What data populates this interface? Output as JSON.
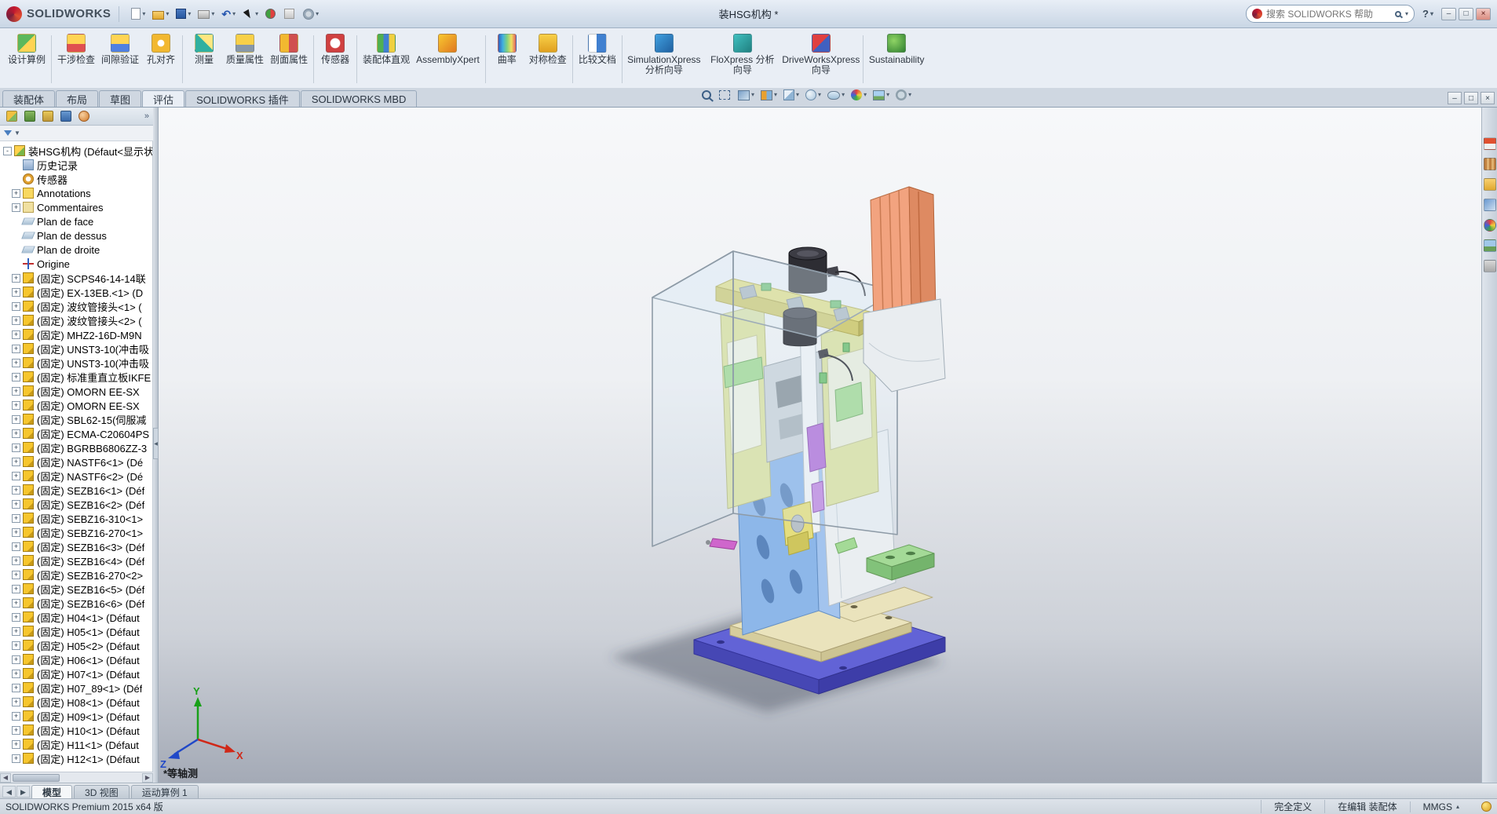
{
  "colors": {
    "titlebar-top": "#e8eef6",
    "titlebar-bottom": "#c9d6e5",
    "ribbon-bg": "#e9eef5",
    "tabrow-bg": "#cfd7e1",
    "panel-bg": "#f2f4f7",
    "tree-bg": "#ffffff",
    "status-bg": "#dde3ea",
    "vp-top": "#f7f8fa",
    "vp-mid": "#cdd1d8",
    "vp-bottom": "#a4aab6",
    "model-base": "#6263d6",
    "model-base-dark": "#4647b4",
    "model-cream": "#eae3bc",
    "model-cream-dark": "#d6cd9d",
    "model-blue": "#8db7e9",
    "model-blue-dark": "#6f9ed6",
    "model-slot": "#5c86bd",
    "model-white": "#eaeef1",
    "model-yellow": "#e5de7e",
    "model-yellow-dark": "#cfc65e",
    "model-ygreen": "#dbe2a2",
    "model-green": "#a4da97",
    "model-green-dark": "#82c27a",
    "model-orange": "#f2a37f",
    "model-orange-dark": "#de8a62",
    "model-orange-light": "#f9c4a4",
    "model-purple": "#b274d9",
    "model-magenta": "#cf66cc",
    "model-black": "#2d2d33",
    "cover-edge": "#8e9ba7"
  },
  "titlebar": {
    "brand": "SOLIDWORKS",
    "doc_title": "装HSG机构 *",
    "search_placeholder": "搜索 SOLIDWORKS 帮助",
    "help_label": "?",
    "help_caret": "▾",
    "qat": [
      {
        "icon": "q-new",
        "caret": "▾"
      },
      {
        "icon": "q-open",
        "caret": "▾"
      },
      {
        "icon": "q-save",
        "caret": "▾"
      },
      {
        "icon": "q-print",
        "caret": "▾"
      },
      {
        "icon": "q-undo",
        "caret": "▾"
      },
      {
        "icon": "q-select",
        "caret": "▾"
      },
      {
        "icon": "q-rebuild",
        "caret": ""
      },
      {
        "icon": "q-props",
        "caret": ""
      },
      {
        "icon": "q-options",
        "caret": "▾"
      }
    ],
    "window_controls": [
      {
        "icon": "wc-min",
        "g": "–"
      },
      {
        "icon": "wc-restore",
        "g": "□"
      },
      {
        "icon": "wc-close",
        "g": "×"
      }
    ]
  },
  "ribbon": {
    "items": [
      {
        "label": "设计算例",
        "icon": "ic-study",
        "type": "btn"
      },
      {
        "label": "",
        "icon": "sep",
        "type": "sep"
      },
      {
        "label": "干涉检查",
        "icon": "ic-interf",
        "type": "btn"
      },
      {
        "label": "间隙验证",
        "icon": "ic-clear",
        "type": "btn"
      },
      {
        "label": "孔对齐",
        "icon": "ic-hole",
        "type": "btn"
      },
      {
        "label": "",
        "icon": "sep",
        "type": "sep"
      },
      {
        "label": "测量",
        "icon": "ic-measure",
        "type": "btn"
      },
      {
        "label": "质量属性",
        "icon": "ic-mass",
        "type": "btn"
      },
      {
        "label": "剖面属性",
        "icon": "ic-section",
        "type": "btn"
      },
      {
        "label": "",
        "icon": "sep",
        "type": "sep"
      },
      {
        "label": "传感器",
        "icon": "ic-sensor",
        "type": "btn"
      },
      {
        "label": "",
        "icon": "sep",
        "type": "sep"
      },
      {
        "label": "装配体直观",
        "icon": "ic-visual",
        "type": "btn"
      },
      {
        "label": "AssemblyXpert",
        "icon": "ic-axpert",
        "type": "btn"
      },
      {
        "label": "",
        "icon": "sep",
        "type": "sep"
      },
      {
        "label": "曲率",
        "icon": "ic-curv",
        "type": "btn"
      },
      {
        "label": "对称检查",
        "icon": "ic-symm",
        "type": "btn"
      },
      {
        "label": "",
        "icon": "sep",
        "type": "sep"
      },
      {
        "label": "比较文档",
        "icon": "ic-compare",
        "type": "btn"
      },
      {
        "label": "",
        "icon": "sep",
        "type": "sep"
      },
      {
        "label": "SimulationXpress 分析向导",
        "icon": "ic-simx",
        "type": "btn"
      },
      {
        "label": "FloXpress 分析向导",
        "icon": "ic-flox",
        "type": "btn"
      },
      {
        "label": "DriveWorksXpress 向导",
        "icon": "ic-dwx",
        "type": "btn"
      },
      {
        "label": "",
        "icon": "sep",
        "type": "sep"
      },
      {
        "label": "Sustainability",
        "icon": "ic-sust",
        "type": "btn"
      }
    ]
  },
  "command_tabs": {
    "items": [
      {
        "label": "装配体",
        "state": "plain"
      },
      {
        "label": "布局",
        "state": "plain"
      },
      {
        "label": "草图",
        "state": "plain"
      },
      {
        "label": "评估",
        "state": "active"
      },
      {
        "label": "SOLIDWORKS 插件",
        "state": "plain"
      },
      {
        "label": "SOLIDWORKS MBD",
        "state": "plain"
      }
    ]
  },
  "hud": {
    "items": [
      {
        "icon": "hud-zoomfit",
        "caret": ""
      },
      {
        "icon": "hud-zoomarea",
        "caret": ""
      },
      {
        "icon": "hud-prev",
        "caret": "▾"
      },
      {
        "icon": "hud-section",
        "caret": "▾"
      },
      {
        "icon": "hud-orient",
        "caret": "▾"
      },
      {
        "icon": "hud-display",
        "caret": "▾"
      },
      {
        "icon": "hud-hideshow",
        "caret": "▾"
      },
      {
        "icon": "hud-appearance",
        "caret": "▾"
      },
      {
        "icon": "hud-scene",
        "caret": "▾"
      },
      {
        "icon": "hud-settings",
        "caret": "▾"
      }
    ]
  },
  "mdi": {
    "items": [
      {
        "icon": "mdi-min",
        "g": "–"
      },
      {
        "icon": "mdi-restore",
        "g": "□"
      },
      {
        "icon": "mdi-close",
        "g": "×"
      }
    ]
  },
  "panel": {
    "tabs": [
      {
        "icon": "pt-tree"
      },
      {
        "icon": "pt-prop"
      },
      {
        "icon": "pt-config"
      },
      {
        "icon": "pt-dim"
      },
      {
        "icon": "pt-display"
      }
    ],
    "overflow": "»",
    "filter_caret": "▼",
    "root": {
      "label": "装HSG机构 (Défaut<显示状",
      "exp": "-"
    },
    "items": [
      {
        "label": "历史记录",
        "icon": "t-history",
        "exp": ""
      },
      {
        "label": "传感器",
        "icon": "t-sensor",
        "exp": ""
      },
      {
        "label": "Annotations",
        "icon": "t-ann",
        "exp": "+"
      },
      {
        "label": "Commentaires",
        "icon": "t-comm",
        "exp": "+"
      },
      {
        "label": "Plan de face",
        "icon": "t-plane",
        "exp": ""
      },
      {
        "label": "Plan de dessus",
        "icon": "t-plane",
        "exp": ""
      },
      {
        "label": "Plan de droite",
        "icon": "t-plane",
        "exp": ""
      },
      {
        "label": "Origine",
        "icon": "t-origin",
        "exp": ""
      },
      {
        "label": "(固定) SCPS46-14-14联",
        "icon": "t-part",
        "exp": "+"
      },
      {
        "label": "(固定) EX-13EB.<1> (D",
        "icon": "t-part",
        "exp": "+"
      },
      {
        "label": "(固定) 波纹管接头<1> (",
        "icon": "t-part",
        "exp": "+"
      },
      {
        "label": "(固定) 波纹管接头<2> (",
        "icon": "t-part",
        "exp": "+"
      },
      {
        "label": "(固定) MHZ2-16D-M9N",
        "icon": "t-part",
        "exp": "+"
      },
      {
        "label": "(固定) UNST3-10(冲击吸",
        "icon": "t-part",
        "exp": "+"
      },
      {
        "label": "(固定) UNST3-10(冲击吸",
        "icon": "t-part",
        "exp": "+"
      },
      {
        "label": "(固定) 标准重直立板IKFE",
        "icon": "t-part",
        "exp": "+"
      },
      {
        "label": "(固定) OMORN  EE-SX",
        "icon": "t-part",
        "exp": "+"
      },
      {
        "label": "(固定) OMORN  EE-SX",
        "icon": "t-part",
        "exp": "+"
      },
      {
        "label": "(固定) SBL62-15(伺服减",
        "icon": "t-part",
        "exp": "+"
      },
      {
        "label": "(固定) ECMA-C20604PS",
        "icon": "t-part",
        "exp": "+"
      },
      {
        "label": "(固定) BGRBB6806ZZ-3",
        "icon": "t-part",
        "exp": "+"
      },
      {
        "label": "(固定) NASTF6<1> (Dé",
        "icon": "t-part",
        "exp": "+"
      },
      {
        "label": "(固定) NASTF6<2> (Dé",
        "icon": "t-part",
        "exp": "+"
      },
      {
        "label": "(固定) SEZB16<1> (Déf",
        "icon": "t-part",
        "exp": "+"
      },
      {
        "label": "(固定) SEZB16<2> (Déf",
        "icon": "t-part",
        "exp": "+"
      },
      {
        "label": "(固定) SEBZ16-310<1>",
        "icon": "t-part",
        "exp": "+"
      },
      {
        "label": "(固定) SEBZ16-270<1>",
        "icon": "t-part",
        "exp": "+"
      },
      {
        "label": "(固定) SEZB16<3> (Déf",
        "icon": "t-part",
        "exp": "+"
      },
      {
        "label": "(固定) SEZB16<4> (Déf",
        "icon": "t-part",
        "exp": "+"
      },
      {
        "label": "(固定) SEZB16-270<2>",
        "icon": "t-part",
        "exp": "+"
      },
      {
        "label": "(固定) SEZB16<5> (Déf",
        "icon": "t-part",
        "exp": "+"
      },
      {
        "label": "(固定) SEZB16<6> (Déf",
        "icon": "t-part",
        "exp": "+"
      },
      {
        "label": "(固定) H04<1> (Défaut",
        "icon": "t-part",
        "exp": "+"
      },
      {
        "label": "(固定) H05<1> (Défaut",
        "icon": "t-part",
        "exp": "+"
      },
      {
        "label": "(固定) H05<2> (Défaut",
        "icon": "t-part",
        "exp": "+"
      },
      {
        "label": "(固定) H06<1> (Défaut",
        "icon": "t-part",
        "exp": "+"
      },
      {
        "label": "(固定) H07<1> (Défaut",
        "icon": "t-part",
        "exp": "+"
      },
      {
        "label": "(固定) H07_89<1> (Déf",
        "icon": "t-part",
        "exp": "+"
      },
      {
        "label": "(固定) H08<1> (Défaut",
        "icon": "t-part",
        "exp": "+"
      },
      {
        "label": "(固定) H09<1> (Défaut",
        "icon": "t-part",
        "exp": "+"
      },
      {
        "label": "(固定) H10<1> (Défaut",
        "icon": "t-part",
        "exp": "+"
      },
      {
        "label": "(固定) H11<1> (Défaut",
        "icon": "t-part",
        "exp": "+"
      },
      {
        "label": "(固定) H12<1> (Défaut",
        "icon": "t-part",
        "exp": "+"
      }
    ]
  },
  "viewport": {
    "view_label": "*等轴测",
    "triad": {
      "x": "X",
      "y": "Y",
      "z": "Z"
    }
  },
  "taskpane": {
    "items": [
      {
        "icon": "tp-home"
      },
      {
        "icon": "tp-lib"
      },
      {
        "icon": "tp-exp"
      },
      {
        "icon": "tp-pal"
      },
      {
        "icon": "tp-app"
      },
      {
        "icon": "tp-scene"
      },
      {
        "icon": "tp-props"
      }
    ]
  },
  "model_tabs": {
    "nav": [
      {
        "g": "◀"
      },
      {
        "g": "▶"
      }
    ],
    "items": [
      {
        "label": "模型",
        "state": "active"
      },
      {
        "label": "3D 视图",
        "state": "plain"
      },
      {
        "label": "运动算例 1",
        "state": "plain"
      }
    ]
  },
  "statusbar": {
    "left": "SOLIDWORKS Premium 2015 x64 版",
    "define_state": "完全定义",
    "editing": "在编辑 装配体",
    "units": "MMGS",
    "units_caret": "▴"
  }
}
